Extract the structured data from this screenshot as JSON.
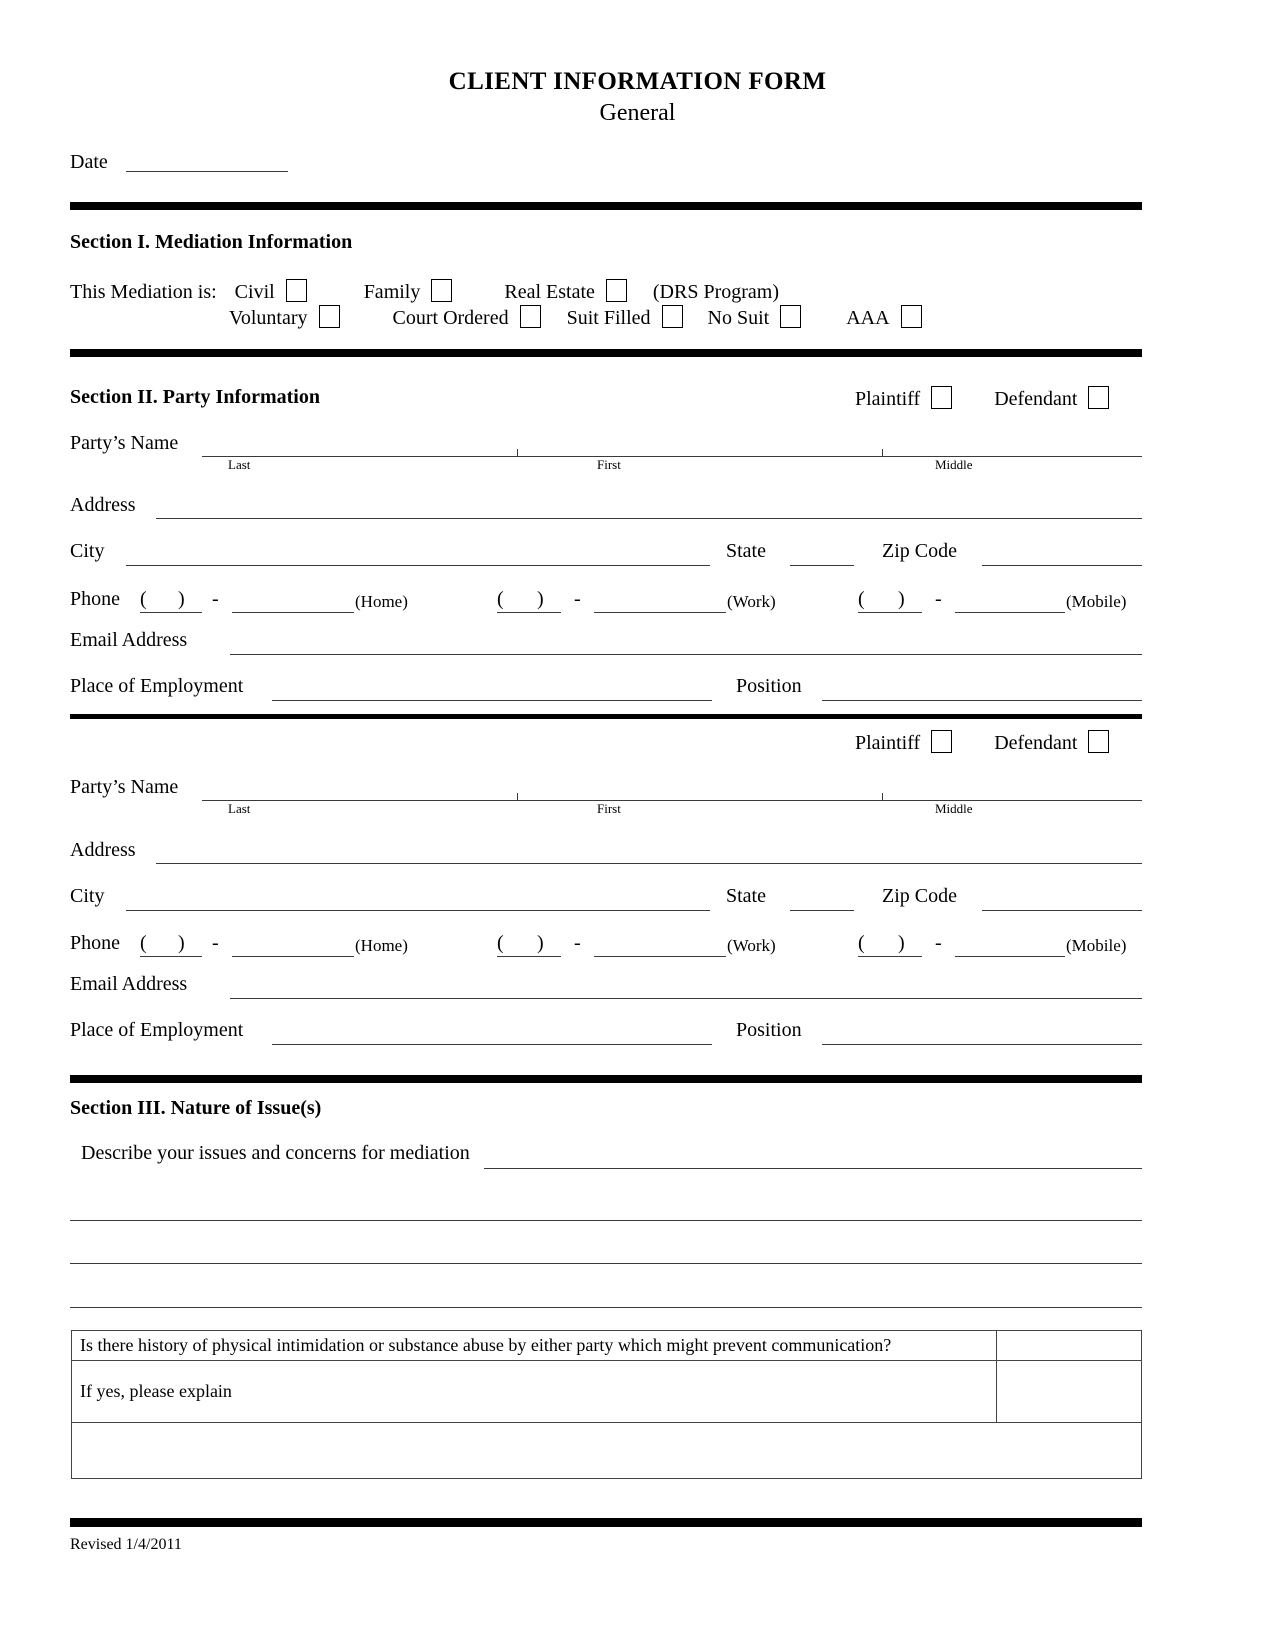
{
  "document": {
    "title": "CLIENT INFORMATION FORM",
    "subtitle": "General",
    "date_label": "Date",
    "revised": "Revised 1/4/2011"
  },
  "section1": {
    "heading": "Section I.  Mediation Information",
    "prompt": "This Mediation is:",
    "row1": [
      {
        "label": "Civil"
      },
      {
        "label": "Family"
      },
      {
        "label": "Real Estate"
      }
    ],
    "row1_note": "(DRS Program)",
    "row2": [
      {
        "label": "Voluntary"
      },
      {
        "label": "Court Ordered"
      },
      {
        "label": "Suit Filled"
      },
      {
        "label": "No Suit"
      },
      {
        "label": "AAA"
      }
    ]
  },
  "section2": {
    "heading": "Section II.  Party Information",
    "plaintiff_label": "Plaintiff",
    "defendant_label": "Defendant",
    "fields": {
      "party_name": "Party’s Name",
      "sub_last": "Last",
      "sub_first": "First",
      "sub_middle": "Middle",
      "address": "Address",
      "city": "City",
      "state": "State",
      "zip": "Zip Code",
      "phone": "Phone",
      "home": "(Home)",
      "work": "(Work)",
      "mobile": "(Mobile)",
      "email": "Email Address",
      "employment": "Place of Employment",
      "position": "Position",
      "paren_open": "(",
      "paren_close": ")",
      "dash": "-"
    }
  },
  "section3": {
    "heading": "Section III.  Nature of Issue(s)",
    "describe_label": "Describe your issues and concerns for mediation"
  },
  "history_table": {
    "question": "Is there history of physical intimidation or substance abuse by either party which might prevent communication?",
    "answer": "",
    "explain_label": "If yes, please explain",
    "explain_value": "",
    "extra_value": ""
  }
}
